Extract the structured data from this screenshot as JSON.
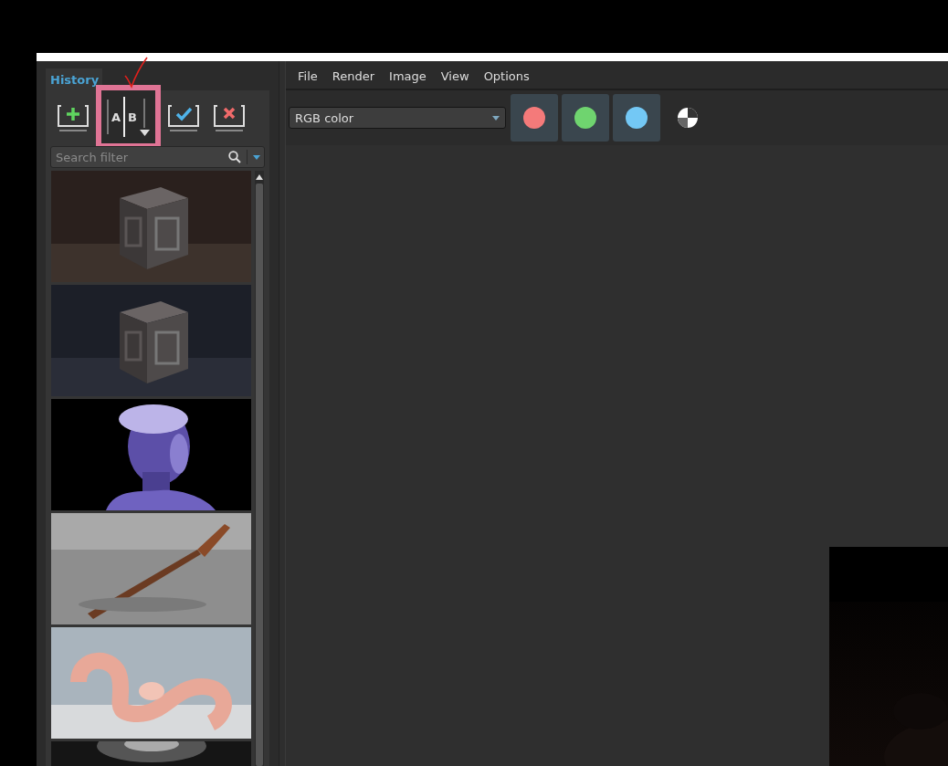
{
  "history": {
    "tab": {
      "label": "History",
      "selected": true
    },
    "toolbar": [
      {
        "kind": "add",
        "highlighted": false
      },
      {
        "kind": "compare",
        "labels": [
          "A",
          "B"
        ],
        "highlighted": true
      },
      {
        "kind": "check",
        "highlighted": false
      },
      {
        "kind": "remove",
        "highlighted": false
      }
    ],
    "search": {
      "placeholder": "Search filter"
    },
    "thumbnails": [
      {
        "kind": "picture"
      },
      {
        "kind": "picture"
      },
      {
        "kind": "picture"
      },
      {
        "kind": "picture"
      },
      {
        "kind": "picture"
      },
      {
        "kind": "picture"
      }
    ]
  },
  "menu": [
    "File",
    "Render",
    "Image",
    "View",
    "Options"
  ],
  "toolbar": {
    "channel_select": {
      "value": "RGB color"
    },
    "channels": [
      {
        "color": "#f47a7a"
      },
      {
        "color": "#6fd46f"
      },
      {
        "color": "#73c8f5"
      }
    ]
  },
  "canvas": {
    "render": {
      "kind": "picture"
    }
  }
}
